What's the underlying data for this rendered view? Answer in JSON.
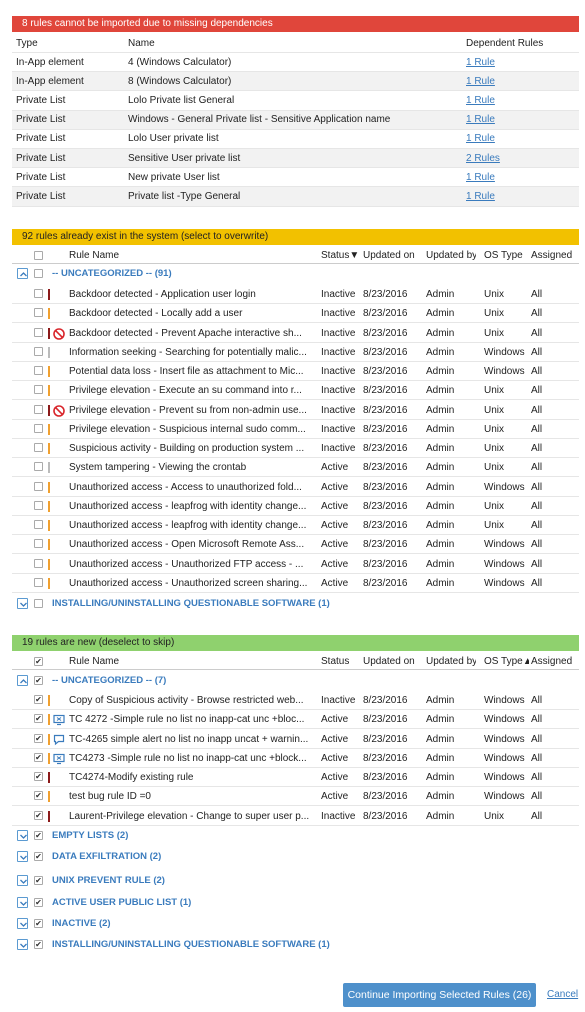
{
  "deps": {
    "banner": "8 rules cannot be imported due to missing dependencies",
    "headers": {
      "type": "Type",
      "name": "Name",
      "dep": "Dependent Rules"
    },
    "rows": [
      {
        "type": "In-App element",
        "name": "4 (Windows Calculator)",
        "dep": "1 Rule"
      },
      {
        "type": "In-App element",
        "name": "8 (Windows Calculator)",
        "dep": "1 Rule"
      },
      {
        "type": "Private List",
        "name": "Lolo Private list General",
        "dep": "1 Rule"
      },
      {
        "type": "Private List",
        "name": "Windows - General Private list - Sensitive Application name",
        "dep": "1 Rule"
      },
      {
        "type": "Private List",
        "name": "Lolo User private list",
        "dep": "1 Rule"
      },
      {
        "type": "Private List",
        "name": "Sensitive User private list",
        "dep": "2 Rules"
      },
      {
        "type": "Private List",
        "name": "New private User list",
        "dep": "1 Rule"
      },
      {
        "type": "Private List",
        "name": "Private list -Type General",
        "dep": "1 Rule"
      }
    ]
  },
  "existing": {
    "banner": "92 rules already exist in the system (select to overwrite)",
    "headers": {
      "name": "Rule Name",
      "status": "Status▼",
      "updated": "Updated on",
      "by": "Updated by",
      "os": "OS Type",
      "assigned": "Assigned"
    },
    "group1": "-- UNCATEGORIZED -- (91)",
    "group2": "INSTALLING/UNINSTALLING QUESTIONABLE SOFTWARE (1)",
    "rows": [
      {
        "bar": "#8b1a1a",
        "icon": "",
        "name": "Backdoor detected - Application user login",
        "status": "Inactive",
        "date": "8/23/2016",
        "by": "Admin",
        "os": "Unix",
        "as": "All"
      },
      {
        "bar": "#f0a030",
        "icon": "",
        "name": "Backdoor detected - Locally add a user",
        "status": "Inactive",
        "date": "8/23/2016",
        "by": "Admin",
        "os": "Unix",
        "as": "All"
      },
      {
        "bar": "#8b1a1a",
        "icon": "prevent-icon",
        "name": "Backdoor detected - Prevent Apache interactive sh...",
        "status": "Inactive",
        "date": "8/23/2016",
        "by": "Admin",
        "os": "Unix",
        "as": "All"
      },
      {
        "bar": "#bbbbbb",
        "icon": "",
        "name": "Information seeking - Searching for potentially malic...",
        "status": "Inactive",
        "date": "8/23/2016",
        "by": "Admin",
        "os": "Windows",
        "as": "All"
      },
      {
        "bar": "#f0a030",
        "icon": "",
        "name": "Potential data loss - Insert file as attachment to Mic...",
        "status": "Inactive",
        "date": "8/23/2016",
        "by": "Admin",
        "os": "Windows",
        "as": "All"
      },
      {
        "bar": "#f0a030",
        "icon": "",
        "name": "Privilege elevation - Execute an su command into r...",
        "status": "Inactive",
        "date": "8/23/2016",
        "by": "Admin",
        "os": "Unix",
        "as": "All"
      },
      {
        "bar": "#8b1a1a",
        "icon": "prevent-icon",
        "name": "Privilege elevation - Prevent su from non-admin use...",
        "status": "Inactive",
        "date": "8/23/2016",
        "by": "Admin",
        "os": "Unix",
        "as": "All"
      },
      {
        "bar": "#f0a030",
        "icon": "",
        "name": "Privilege elevation - Suspicious internal sudo comm...",
        "status": "Inactive",
        "date": "8/23/2016",
        "by": "Admin",
        "os": "Unix",
        "as": "All"
      },
      {
        "bar": "#f0a030",
        "icon": "",
        "name": "Suspicious activity - Building on production system ...",
        "status": "Inactive",
        "date": "8/23/2016",
        "by": "Admin",
        "os": "Unix",
        "as": "All"
      },
      {
        "bar": "#bbbbbb",
        "icon": "",
        "name": "System tampering - Viewing the crontab",
        "status": "Active",
        "date": "8/23/2016",
        "by": "Admin",
        "os": "Unix",
        "as": "All"
      },
      {
        "bar": "#f0a030",
        "icon": "",
        "name": "Unauthorized access - Access to unauthorized fold...",
        "status": "Active",
        "date": "8/23/2016",
        "by": "Admin",
        "os": "Windows",
        "as": "All"
      },
      {
        "bar": "#f0a030",
        "icon": "",
        "name": "Unauthorized access - leapfrog with identity change...",
        "status": "Active",
        "date": "8/23/2016",
        "by": "Admin",
        "os": "Unix",
        "as": "All"
      },
      {
        "bar": "#f0a030",
        "icon": "",
        "name": "Unauthorized access - leapfrog with identity change...",
        "status": "Active",
        "date": "8/23/2016",
        "by": "Admin",
        "os": "Unix",
        "as": "All"
      },
      {
        "bar": "#f0a030",
        "icon": "",
        "name": "Unauthorized access - Open Microsoft Remote Ass...",
        "status": "Active",
        "date": "8/23/2016",
        "by": "Admin",
        "os": "Windows",
        "as": "All"
      },
      {
        "bar": "#f0a030",
        "icon": "",
        "name": "Unauthorized access - Unauthorized FTP access - ...",
        "status": "Active",
        "date": "8/23/2016",
        "by": "Admin",
        "os": "Windows",
        "as": "All"
      },
      {
        "bar": "#f0a030",
        "icon": "",
        "name": "Unauthorized access - Unauthorized screen sharing...",
        "status": "Active",
        "date": "8/23/2016",
        "by": "Admin",
        "os": "Windows",
        "as": "All"
      }
    ]
  },
  "newrules": {
    "banner": "19 rules are new (deselect to skip)",
    "headers": {
      "name": "Rule Name",
      "status": "Status",
      "updated": "Updated on",
      "by": "Updated by",
      "os": "OS Type▲",
      "assigned": "Assigned"
    },
    "group1": "-- UNCATEGORIZED -- (7)",
    "rows": [
      {
        "bar": "#f0a030",
        "icon": "",
        "name": "Copy of Suspicious activity - Browse restricted web...",
        "status": "Inactive",
        "date": "8/23/2016",
        "by": "Admin",
        "os": "Windows",
        "as": "All"
      },
      {
        "bar": "#f0a030",
        "icon": "screen-icon",
        "name": "TC 4272 -Simple rule no list no inapp-cat unc +bloc...",
        "status": "Active",
        "date": "8/23/2016",
        "by": "Admin",
        "os": "Windows",
        "as": "All"
      },
      {
        "bar": "#f0a030",
        "icon": "message-icon",
        "name": "TC-4265 simple alert no list no inapp uncat + warnin...",
        "status": "Active",
        "date": "8/23/2016",
        "by": "Admin",
        "os": "Windows",
        "as": "All"
      },
      {
        "bar": "#f0a030",
        "icon": "screen-icon",
        "name": "TC4273 -Simple rule no list no inapp-cat unc +block...",
        "status": "Active",
        "date": "8/23/2016",
        "by": "Admin",
        "os": "Windows",
        "as": "All"
      },
      {
        "bar": "#8b1a1a",
        "icon": "",
        "name": "TC4274-Modify existing rule",
        "status": "Active",
        "date": "8/23/2016",
        "by": "Admin",
        "os": "Windows",
        "as": "All"
      },
      {
        "bar": "#f0a030",
        "icon": "",
        "name": "test bug rule ID =0",
        "status": "Active",
        "date": "8/23/2016",
        "by": "Admin",
        "os": "Windows",
        "as": "All"
      },
      {
        "bar": "#8b1a1a",
        "icon": "",
        "name": "Laurent-Privilege elevation - Change to super user p...",
        "status": "Inactive",
        "date": "8/23/2016",
        "by": "Admin",
        "os": "Unix",
        "as": "All"
      }
    ],
    "groups": [
      "EMPTY LISTS (2)",
      "DATA EXFILTRATION (2)",
      "UNIX PREVENT RULE (2)",
      "ACTIVE USER PUBLIC LIST (1)",
      "INACTIVE (2)",
      "INSTALLING/UNINSTALLING QUESTIONABLE SOFTWARE (1)"
    ]
  },
  "footer": {
    "continue": "Continue Importing Selected Rules (26)",
    "cancel": "Cancel"
  },
  "colors": {
    "red": "#e0463b",
    "yellow": "#f2c100",
    "green": "#8fd16e",
    "accent": "#4e90cb"
  }
}
